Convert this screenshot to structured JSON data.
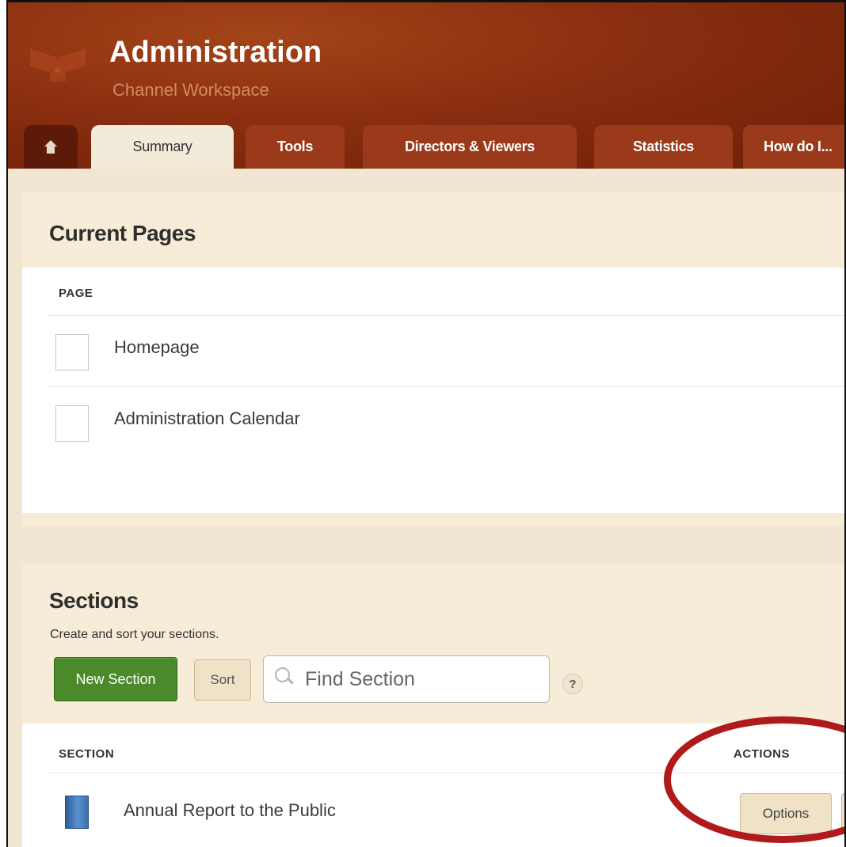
{
  "header": {
    "title": "Administration",
    "subtitle": "Channel Workspace",
    "tabs": [
      {
        "label": "Summary",
        "active": true
      },
      {
        "label": "Tools",
        "active": false
      },
      {
        "label": "Directors & Viewers",
        "active": false
      },
      {
        "label": "Statistics",
        "active": false
      },
      {
        "label": "How do I...",
        "active": false
      }
    ]
  },
  "current_pages": {
    "title": "Current Pages",
    "column_header": "PAGE",
    "pages": [
      {
        "name": "Homepage"
      },
      {
        "name": "Administration Calendar"
      }
    ]
  },
  "sections": {
    "title": "Sections",
    "description": "Create and sort your sections.",
    "new_button": "New Section",
    "sort_button": "Sort",
    "search_placeholder": "Find Section",
    "help_symbol": "?",
    "column_section": "SECTION",
    "column_actions": "ACTIONS",
    "rows": [
      {
        "name": "Annual Report to the Public",
        "icon": "book-icon",
        "action": "Options"
      }
    ]
  },
  "colors": {
    "header_bg": "#8a2e10",
    "panel_bg": "#f6ecd8",
    "new_button_bg": "#4b8a2a",
    "highlight_circle": "#b01a1a"
  }
}
